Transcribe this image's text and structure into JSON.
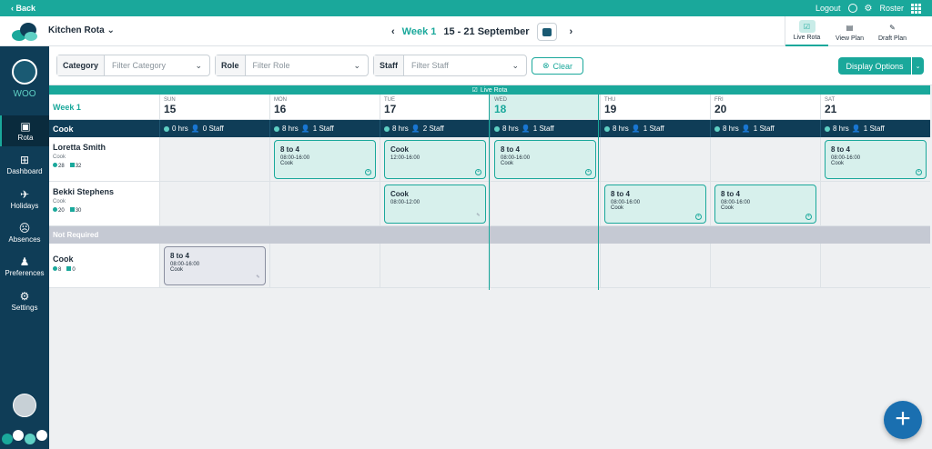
{
  "topbar": {
    "back": "‹ Back",
    "logout": "Logout",
    "roster": "Roster"
  },
  "header": {
    "title": "Kitchen Rota",
    "week": "Week 1",
    "range": "15 - 21 September"
  },
  "views": [
    {
      "label": "Live Rota",
      "icon": "calendar-check-icon"
    },
    {
      "label": "View Plan",
      "icon": "briefcase-icon"
    },
    {
      "label": "Draft Plan",
      "icon": "pencil-icon"
    }
  ],
  "sidebar": {
    "brand": "WOO",
    "items": [
      {
        "label": "Rota",
        "icon": "calendar-icon",
        "glyph": "▣"
      },
      {
        "label": "Dashboard",
        "icon": "dashboard-icon",
        "glyph": "⊞"
      },
      {
        "label": "Holidays",
        "icon": "holiday-icon",
        "glyph": "✈"
      },
      {
        "label": "Absences",
        "icon": "absences-icon",
        "glyph": "☹"
      },
      {
        "label": "Preferences",
        "icon": "preferences-icon",
        "glyph": "♟"
      },
      {
        "label": "Settings",
        "icon": "gear-icon",
        "glyph": "⚙"
      }
    ]
  },
  "filters": {
    "category": {
      "label": "Category",
      "placeholder": "Filter Category"
    },
    "role": {
      "label": "Role",
      "placeholder": "Filter Role"
    },
    "staff": {
      "label": "Staff",
      "placeholder": "Filter Staff"
    },
    "clear": "Clear",
    "display_options": "Display Options"
  },
  "banner": "Live Rota",
  "grid": {
    "week_label": "Week 1",
    "days": [
      {
        "name": "SUN",
        "num": "15"
      },
      {
        "name": "MON",
        "num": "16"
      },
      {
        "name": "TUE",
        "num": "17"
      },
      {
        "name": "WED",
        "num": "18"
      },
      {
        "name": "THU",
        "num": "19"
      },
      {
        "name": "FRI",
        "num": "20"
      },
      {
        "name": "SAT",
        "num": "21"
      }
    ],
    "role": "Cook",
    "role_summary": [
      {
        "hrs": "0 hrs",
        "staff": "0 Staff"
      },
      {
        "hrs": "8 hrs",
        "staff": "1 Staff"
      },
      {
        "hrs": "8 hrs",
        "staff": "2 Staff"
      },
      {
        "hrs": "8 hrs",
        "staff": "1 Staff"
      },
      {
        "hrs": "8 hrs",
        "staff": "1 Staff"
      },
      {
        "hrs": "8 hrs",
        "staff": "1 Staff"
      },
      {
        "hrs": "8 hrs",
        "staff": "1 Staff"
      }
    ],
    "staff": [
      {
        "name": "Loretta Smith",
        "role": "Cook",
        "stat1": "28",
        "stat2": "32"
      },
      {
        "name": "Bekki Stephens",
        "role": "Cook",
        "stat1": "20",
        "stat2": "30"
      }
    ],
    "not_required": "Not Required",
    "nr_row": {
      "name": "Cook",
      "stat1": "8",
      "stat2": "0"
    },
    "shift_a": {
      "title": "8 to 4",
      "time": "08:00-16:00",
      "role": "Cook"
    },
    "shift_b": {
      "title": "Cook",
      "time": "12:00-16:00"
    },
    "shift_c": {
      "title": "Cook",
      "time": "08:00-12:00"
    }
  }
}
